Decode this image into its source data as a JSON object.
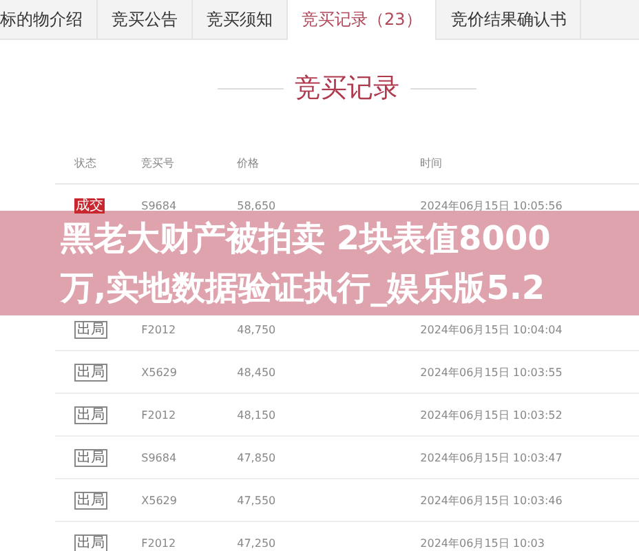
{
  "tabs": [
    {
      "label": "标的物介绍",
      "selected": false
    },
    {
      "label": "竞买公告",
      "selected": false
    },
    {
      "label": "竞买须知",
      "selected": false
    },
    {
      "label": "竞买记录（23）",
      "selected": true
    },
    {
      "label": "竞价结果确认书",
      "selected": false
    }
  ],
  "section_title": "竞买记录",
  "table": {
    "columns": [
      "状态",
      "竞买号",
      "价格",
      "时间"
    ],
    "rows": [
      {
        "status": "成交",
        "kind": "won",
        "bidder": "S9684",
        "price": "58,650",
        "time": "2024年06月15日 10:05:56"
      },
      {
        "status": "出局",
        "kind": "out",
        "bidder": "F2012",
        "price": "48,750",
        "time": "2024年06月15日 10:04:04"
      },
      {
        "status": "出局",
        "kind": "out",
        "bidder": "X5629",
        "price": "48,450",
        "time": "2024年06月15日 10:03:55"
      },
      {
        "status": "出局",
        "kind": "out",
        "bidder": "F2012",
        "price": "48,150",
        "time": "2024年06月15日 10:03:52"
      },
      {
        "status": "出局",
        "kind": "out",
        "bidder": "S9684",
        "price": "47,850",
        "time": "2024年06月15日 10:03:47"
      },
      {
        "status": "出局",
        "kind": "out",
        "bidder": "X5629",
        "price": "47,550",
        "time": "2024年06月15日 10:03:46"
      },
      {
        "status": "出局",
        "kind": "out",
        "bidder": "F2012",
        "price": "47,250",
        "time": "2024年06月15日 10:03"
      }
    ]
  },
  "headline": "黑老大财产被拍卖 2块表值8000万,实地数据验证执行_娱乐版5.2"
}
